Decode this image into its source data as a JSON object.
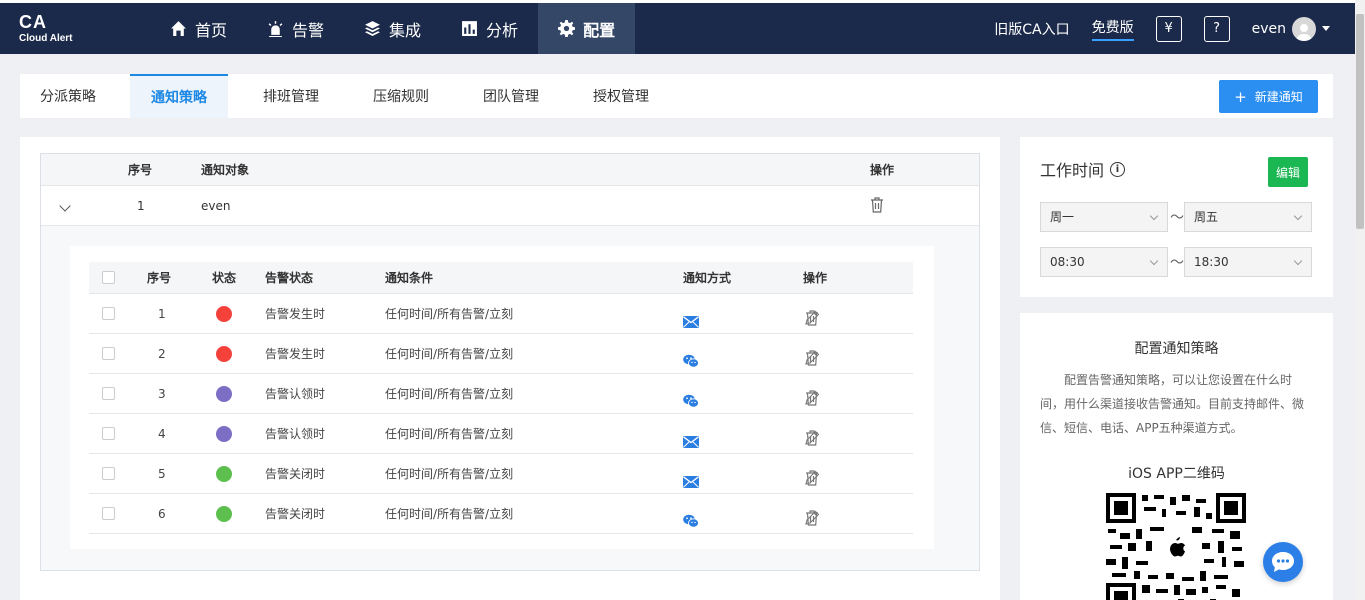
{
  "logo": {
    "big": "CA",
    "small": "Cloud Alert"
  },
  "nav": [
    {
      "label": "首页",
      "icon": "home-icon"
    },
    {
      "label": "告警",
      "icon": "alarm-icon"
    },
    {
      "label": "集成",
      "icon": "layers-icon"
    },
    {
      "label": "分析",
      "icon": "bar-chart-icon"
    },
    {
      "label": "配置",
      "icon": "gear-icon",
      "active": true
    }
  ],
  "nav_right": {
    "old_entry": "旧版CA入口",
    "free": "免费版",
    "yen": "¥",
    "help": "?",
    "user": "even"
  },
  "subtabs": [
    "分派策略",
    "通知策略",
    "排班管理",
    "压缩规则",
    "团队管理",
    "授权管理"
  ],
  "new_button": {
    "plus": "+",
    "label": "新建通知"
  },
  "outer_table": {
    "headers": {
      "index": "序号",
      "target": "通知对象",
      "ops": "操作"
    },
    "row": {
      "index": "1",
      "target": "even"
    }
  },
  "inner_table": {
    "headers": {
      "index": "序号",
      "status": "状态",
      "alert_status": "告警状态",
      "condition": "通知条件",
      "method": "通知方式",
      "ops": "操作"
    },
    "rows": [
      {
        "index": "1",
        "status_color": "#f5413c",
        "alert_status": "告警发生时",
        "condition": "任何时间/所有告警/立刻",
        "method": "email-icon"
      },
      {
        "index": "2",
        "status_color": "#f5413c",
        "alert_status": "告警发生时",
        "condition": "任何时间/所有告警/立刻",
        "method": "wechat-icon"
      },
      {
        "index": "3",
        "status_color": "#7b6ec4",
        "alert_status": "告警认领时",
        "condition": "任何时间/所有告警/立刻",
        "method": "wechat-icon"
      },
      {
        "index": "4",
        "status_color": "#7b6ec4",
        "alert_status": "告警认领时",
        "condition": "任何时间/所有告警/立刻",
        "method": "email-icon"
      },
      {
        "index": "5",
        "status_color": "#5cbf4e",
        "alert_status": "告警关闭时",
        "condition": "任何时间/所有告警/立刻",
        "method": "email-icon"
      },
      {
        "index": "6",
        "status_color": "#5cbf4e",
        "alert_status": "告警关闭时",
        "condition": "任何时间/所有告警/立刻",
        "method": "wechat-icon"
      }
    ]
  },
  "worktime": {
    "title": "工作时间",
    "info": "i",
    "edit": "编辑",
    "day_from": "周一",
    "day_to": "周五",
    "time_from": "08:30",
    "time_to": "18:30",
    "tilde": "～"
  },
  "help": {
    "title": "配置通知策略",
    "text": "配置告警通知策略，可以让您设置在什么时间，用什么渠道接收告警通知。目前支持邮件、微信、短信、电话、APP五种渠道方式。",
    "qr_title": "iOS APP二维码"
  },
  "colors": {
    "nav_bg": "#1b2a4a",
    "accent": "#1e88e5",
    "edit_green": "#1bb753"
  }
}
